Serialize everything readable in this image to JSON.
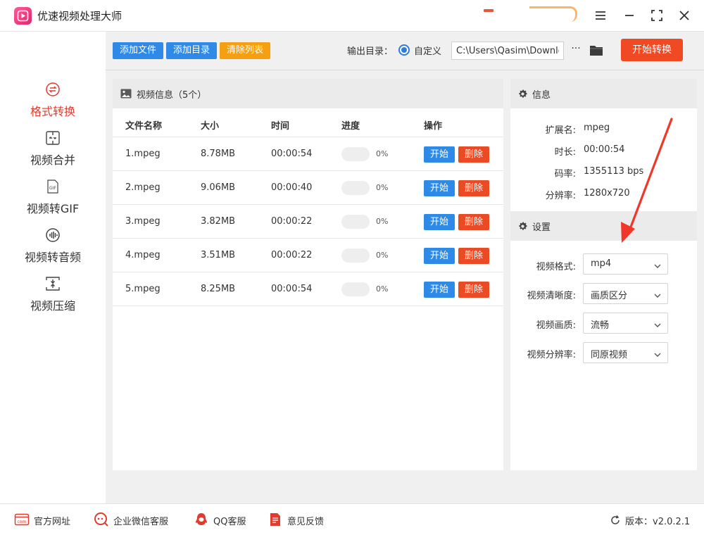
{
  "app": {
    "title": "优速视频处理大师"
  },
  "sidebar": {
    "items": [
      {
        "label": "格式转换",
        "icon": "format-convert-icon",
        "active": true
      },
      {
        "label": "视频合并",
        "icon": "video-merge-icon",
        "active": false
      },
      {
        "label": "视频转GIF",
        "icon": "gif-icon",
        "active": false
      },
      {
        "label": "视频转音频",
        "icon": "audio-icon",
        "active": false
      },
      {
        "label": "视频压缩",
        "icon": "compress-icon",
        "active": false
      }
    ]
  },
  "toolbar": {
    "add_file": "添加文件",
    "add_dir": "添加目录",
    "clear_list": "清除列表",
    "output_label": "输出目录：",
    "output_option": "自定义",
    "output_path": "C:\\Users\\Qasim\\Downloads",
    "more": "···",
    "start_all": "开始转换"
  },
  "video_panel": {
    "title": "视频信息（5个）",
    "columns": {
      "name": "文件名称",
      "size": "大小",
      "time": "时间",
      "progress": "进度",
      "action": "操作"
    },
    "start_label": "开始",
    "delete_label": "删除",
    "rows": [
      {
        "name": "1.mpeg",
        "size": "8.78MB",
        "time": "00:00:54",
        "progress": 0,
        "progress_text": "0%"
      },
      {
        "name": "2.mpeg",
        "size": "9.06MB",
        "time": "00:00:40",
        "progress": 0,
        "progress_text": "0%"
      },
      {
        "name": "3.mpeg",
        "size": "3.82MB",
        "time": "00:00:22",
        "progress": 0,
        "progress_text": "0%"
      },
      {
        "name": "4.mpeg",
        "size": "3.51MB",
        "time": "00:00:22",
        "progress": 0,
        "progress_text": "0%"
      },
      {
        "name": "5.mpeg",
        "size": "8.25MB",
        "time": "00:00:54",
        "progress": 0,
        "progress_text": "0%"
      }
    ]
  },
  "info": {
    "title": "信息",
    "ext_label": "扩展名:",
    "ext_value": "mpeg",
    "duration_label": "时长:",
    "duration_value": "00:00:54",
    "bitrate_label": "码率:",
    "bitrate_value": "1355113 bps",
    "resolution_label": "分辨率:",
    "resolution_value": "1280x720"
  },
  "settings": {
    "title": "设置",
    "format_label": "视频格式:",
    "format_value": "mp4",
    "clarity_label": "视频清晰度:",
    "clarity_value": "画质区分",
    "quality_label": "视频画质:",
    "quality_value": "流畅",
    "resolution_label": "视频分辨率:",
    "resolution_value": "同原视频"
  },
  "footer": {
    "website": "官方网址",
    "wechat": "企业微信客服",
    "qq": "QQ客服",
    "feedback": "意见反馈",
    "version": "版本：v2.0.2.1"
  },
  "colors": {
    "accent_blue": "#2e8ae6",
    "accent_red": "#f04a25",
    "accent_orange": "#f5a012",
    "active_nav": "#e03b2e"
  }
}
